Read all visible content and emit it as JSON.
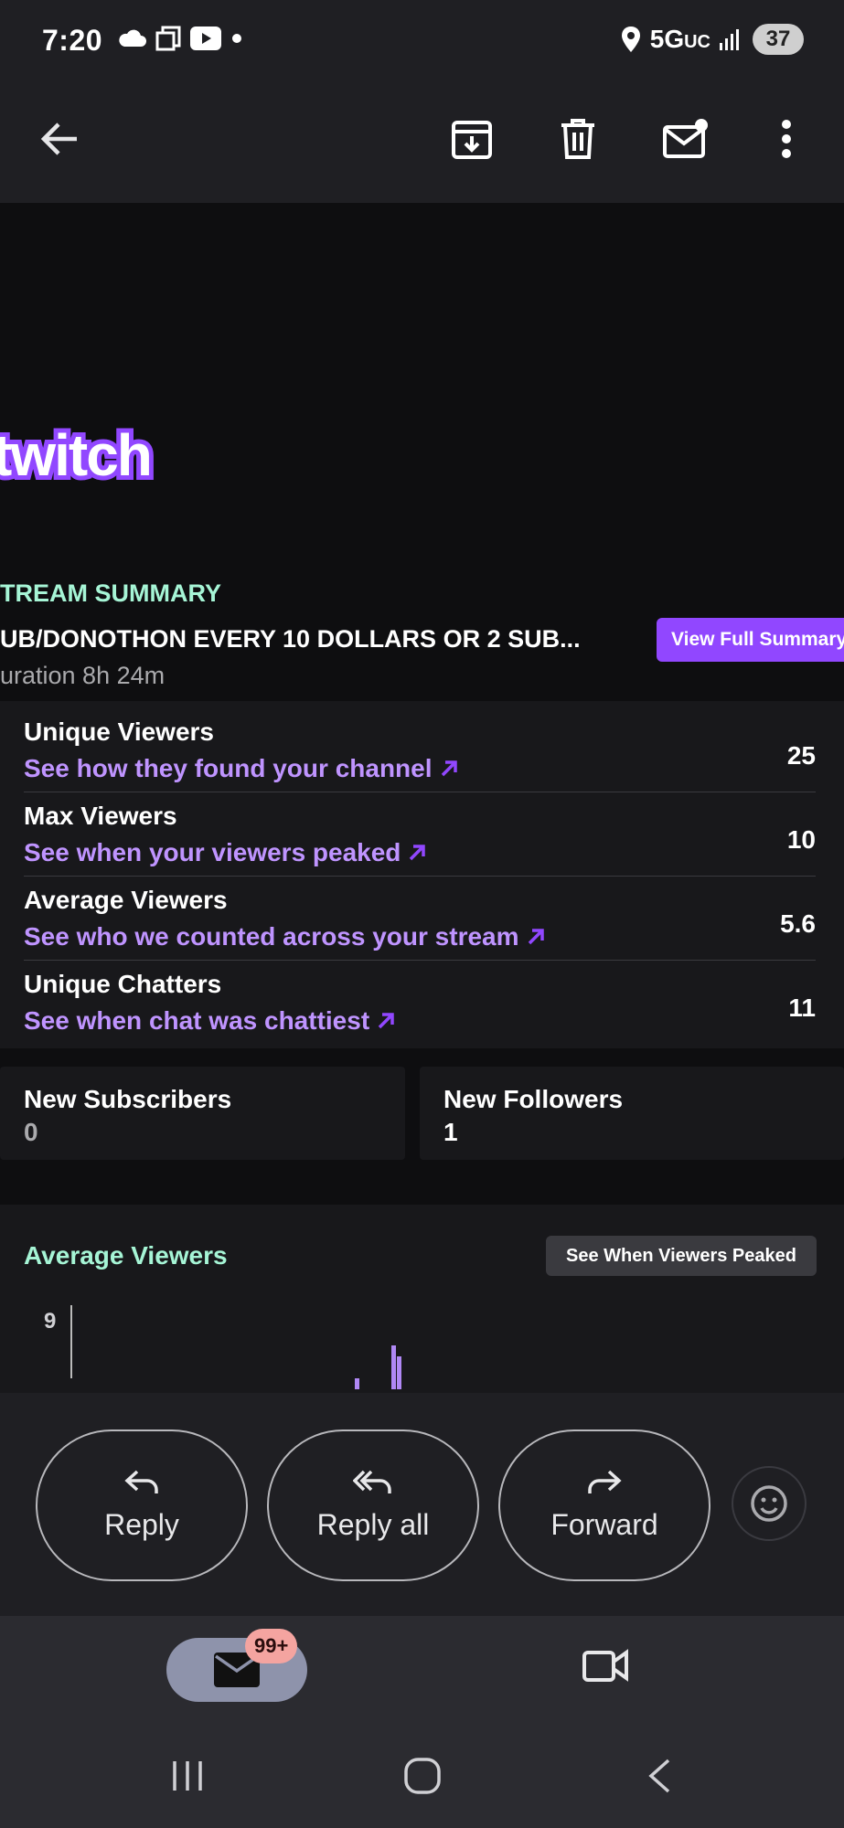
{
  "status_bar": {
    "time": "7:20",
    "network": "5G",
    "network_suffix": "UC",
    "battery": "37"
  },
  "app_bar": {
    "back_icon": "arrow-back-icon",
    "archive_icon": "archive-icon",
    "delete_icon": "trash-icon",
    "mark_unread_icon": "mail-unread-icon",
    "more_icon": "more-vert-icon"
  },
  "email": {
    "logo_text": "twitch",
    "summary_label": "TREAM SUMMARY",
    "stream_title": "UB/DONOTHON EVERY 10 DOLLARS OR 2 SUB...",
    "duration": "uration 8h 24m",
    "view_full_button": "View Full Summary",
    "stats": [
      {
        "name": "Unique Viewers",
        "link": "See how they found your channel",
        "value": "25"
      },
      {
        "name": "Max Viewers",
        "link": "See when your viewers peaked",
        "value": "10"
      },
      {
        "name": "Average Viewers",
        "link": "See who we counted across your stream",
        "value": "5.6"
      },
      {
        "name": "Unique Chatters",
        "link": "See when chat was chattiest",
        "value": "11"
      }
    ],
    "new_subscribers": {
      "label": "New Subscribers",
      "value": "0"
    },
    "new_followers": {
      "label": "New Followers",
      "value": "1"
    },
    "average_section": {
      "title": "Average Viewers",
      "button": "See When Viewers Peaked",
      "y_tick": "9"
    },
    "colors": {
      "accent": "#9147ff",
      "link": "#bf94ff",
      "mint": "#a6f5d6"
    }
  },
  "chart_data": {
    "type": "bar",
    "title": "Average Viewers",
    "y_ticks": [
      "9"
    ],
    "values_visible": [
      1,
      4,
      3
    ],
    "note_only_partial_visible": true
  },
  "actions": {
    "reply": "Reply",
    "reply_all": "Reply all",
    "forward": "Forward",
    "emoji_icon": "emoji-icon"
  },
  "bottom_nav": {
    "mail_badge": "99+",
    "mail_icon": "mail-icon",
    "meet_icon": "video-icon"
  }
}
